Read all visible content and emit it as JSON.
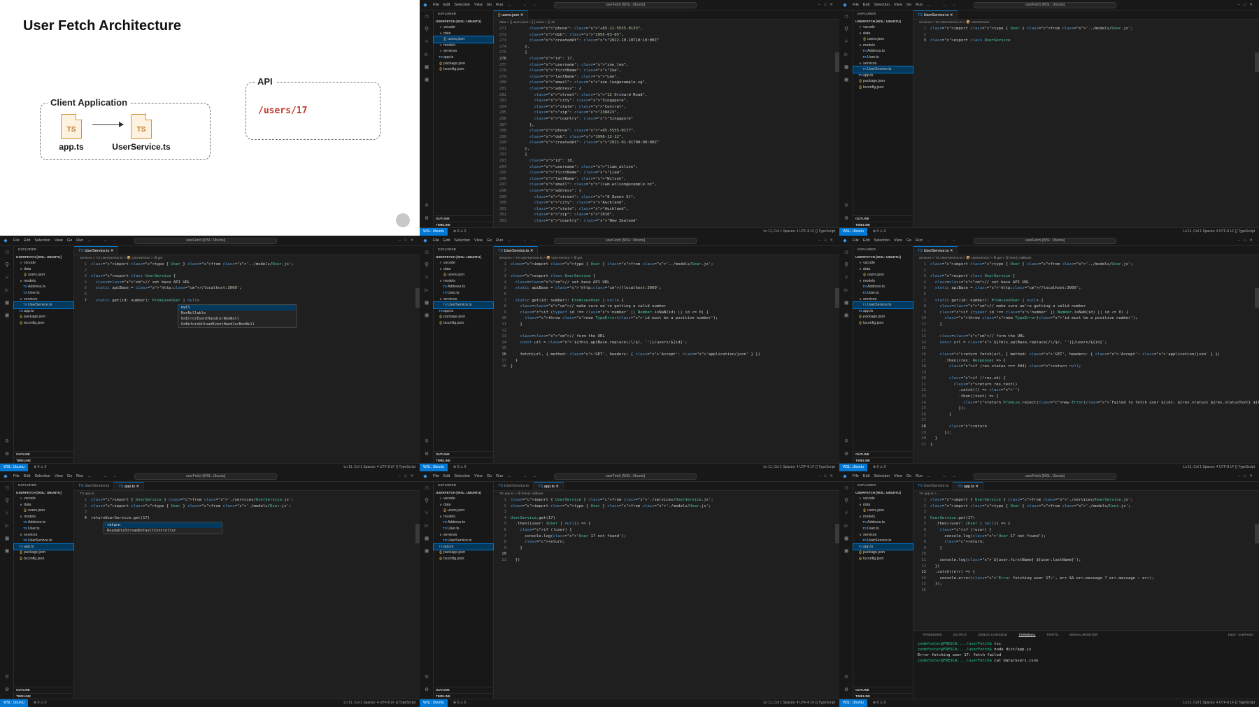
{
  "diagram": {
    "title": "User Fetch Architecture",
    "client_label": "Client Application",
    "api_label": "API",
    "route": "/users/17",
    "files": [
      "app.ts",
      "UserService.ts"
    ],
    "file_badge": "TS"
  },
  "common": {
    "menus": [
      "File",
      "Edit",
      "Selection",
      "View",
      "Go",
      "Run",
      "…"
    ],
    "search": "userFetch [WSL: Ubuntu]",
    "explorer_header": "EXPLORER",
    "root": "USERFETCH [WSL: UBUNTU]",
    "outline": "OUTLINE",
    "timeline": "TIMELINE",
    "remote": "WSL: Ubuntu",
    "problems": "⊗ 0 ⚠ 0",
    "ports": "0",
    "status_right": "Ln 11, Col 1   Spaces: 4   UTF-8   LF   {} TypeScript"
  },
  "panes": [
    null,
    {
      "tabs": [
        {
          "label": "users.json",
          "active": true,
          "icon": "{}"
        }
      ],
      "crumbs": "data > {} users.json > [ ] users > {} 16",
      "tree": [
        {
          "label": "vscode",
          "d": 1,
          "icon": ">"
        },
        {
          "label": "data",
          "d": 1,
          "icon": "v"
        },
        {
          "label": "users.json",
          "d": 2,
          "icon": "{}",
          "sel": true
        },
        {
          "label": "models",
          "d": 1,
          "icon": ">"
        },
        {
          "label": "services",
          "d": 1,
          "icon": ">"
        },
        {
          "label": "app.ts",
          "d": 1,
          "icon": "TS"
        },
        {
          "label": "package.json",
          "d": 1,
          "icon": "{}"
        },
        {
          "label": "tsconfig.json",
          "d": 1,
          "icon": "{}"
        }
      ],
      "start": 271,
      "cur": 276,
      "code": [
        "        \"phone\": \"+65-11-5555-0133\",",
        "        \"dob\": \"1995-03-05\",",
        "        \"createdAt\": \"2022-10-10T10:10:00Z\"",
        "      },",
        "      {",
        "        \"id\": 17,",
        "        \"username\": \"zoe_lee\",",
        "        \"firstName\": \"Zoe\",",
        "        \"lastName\": \"Lee\",",
        "        \"email\": \"zoe.lee@example.sg\",",
        "        \"address\": {",
        "          \"street\": \"12 Orchard Road\",",
        "          \"city\": \"Singapore\",",
        "          \"state\": \"Central\",",
        "          \"zip\": \"238823\",",
        "          \"country\": \"Singapore\"",
        "        },",
        "        \"phone\": \"+65-5555-0177\",",
        "        \"dob\": \"1996-12-12\",",
        "        \"createdAt\": \"2021-01-01T00:00:00Z\"",
        "      },",
        "      {",
        "        \"id\": 18,",
        "        \"username\": \"liam_wilson\",",
        "        \"firstName\": \"Liam\",",
        "        \"lastName\": \"Wilson\",",
        "        \"email\": \"liam.wilson@example.nz\",",
        "        \"address\": {",
        "          \"street\": \"8 Queen St\",",
        "          \"city\": \"Auckland\",",
        "          \"state\": \"Auckland\",",
        "          \"zip\": \"1010\",",
        "          \"country\": \"New Zealand\""
      ]
    },
    {
      "tabs": [
        {
          "label": "UserService.ts",
          "active": true,
          "icon": "TS"
        }
      ],
      "crumbs": "services > TS UserService.ts > 📦 UserService",
      "tree": [
        {
          "label": "vscode",
          "d": 1,
          "icon": ">"
        },
        {
          "label": "data",
          "d": 1,
          "icon": "v"
        },
        {
          "label": "users.json",
          "d": 2,
          "icon": "{}"
        },
        {
          "label": "models",
          "d": 1,
          "icon": "v"
        },
        {
          "label": "Address.ts",
          "d": 2,
          "icon": "TS"
        },
        {
          "label": "User.ts",
          "d": 2,
          "icon": "TS"
        },
        {
          "label": "services",
          "d": 1,
          "icon": "v"
        },
        {
          "label": "UserService.ts",
          "d": 2,
          "icon": "TS",
          "sel": true
        },
        {
          "label": "app.ts",
          "d": 1,
          "icon": "TS"
        },
        {
          "label": "package.json",
          "d": 1,
          "icon": "{}"
        },
        {
          "label": "tsconfig.json",
          "d": 1,
          "icon": "{}"
        }
      ],
      "start": 1,
      "cur": 3,
      "code": [
        "import type { User } from '../models/User.js';",
        "",
        "export class UserService"
      ]
    },
    {
      "tabs": [
        {
          "label": "UserService.ts",
          "active": true,
          "icon": "TS"
        }
      ],
      "crumbs": "services > TS UserService.ts > 📦 UserService > ⚙ get",
      "tree": [
        {
          "label": "vscode",
          "d": 1,
          "icon": ">"
        },
        {
          "label": "data",
          "d": 1,
          "icon": "v"
        },
        {
          "label": "users.json",
          "d": 2,
          "icon": "{}"
        },
        {
          "label": "models",
          "d": 1,
          "icon": "v"
        },
        {
          "label": "Address.ts",
          "d": 2,
          "icon": "TS"
        },
        {
          "label": "User.ts",
          "d": 2,
          "icon": "TS"
        },
        {
          "label": "services",
          "d": 1,
          "icon": "v"
        },
        {
          "label": "UserService.ts",
          "d": 2,
          "icon": "TS",
          "sel": true
        },
        {
          "label": "app.ts",
          "d": 1,
          "icon": "TS"
        },
        {
          "label": "package.json",
          "d": 1,
          "icon": "{}"
        },
        {
          "label": "tsconfig.json",
          "d": 1,
          "icon": "{}"
        }
      ],
      "start": 1,
      "cur": 7,
      "code": [
        "import type { User } from '../models/User.js';",
        "",
        "export class UserService {",
        "  // set base API URL",
        "  static apiBase = 'http://localhost:3000';",
        "",
        "  static get(id: number): Promise<User | null>"
      ],
      "popup": {
        "items": [
          "null",
          "NonNullable",
          "OnErrorEventHandlerNonNull",
          "OnBeforeUnloadEventHandlerNonNull"
        ],
        "hint": "null"
      }
    },
    {
      "tabs": [
        {
          "label": "UserService.ts",
          "active": true,
          "icon": "TS"
        }
      ],
      "crumbs": "services > TS UserService.ts > 📦 UserService > ⚙ get",
      "tree": [
        {
          "label": "vscode",
          "d": 1,
          "icon": ">"
        },
        {
          "label": "data",
          "d": 1,
          "icon": "v"
        },
        {
          "label": "users.json",
          "d": 2,
          "icon": "{}"
        },
        {
          "label": "models",
          "d": 1,
          "icon": "v"
        },
        {
          "label": "Address.ts",
          "d": 2,
          "icon": "TS"
        },
        {
          "label": "User.ts",
          "d": 2,
          "icon": "TS"
        },
        {
          "label": "services",
          "d": 1,
          "icon": "v"
        },
        {
          "label": "UserService.ts",
          "d": 2,
          "icon": "TS",
          "sel": true
        },
        {
          "label": "app.ts",
          "d": 1,
          "icon": "TS"
        },
        {
          "label": "package.json",
          "d": 1,
          "icon": "{}"
        },
        {
          "label": "tsconfig.json",
          "d": 1,
          "icon": "{}"
        }
      ],
      "start": 1,
      "cur": 16,
      "code": [
        "import type { User } from '../models/User.js';",
        "",
        "export class UserService {",
        "  // set base API URL",
        "  static apiBase = 'http://localhost:3000';",
        "",
        "  static get(id: number): Promise<User | null> {",
        "    // make sure we're getting a valid number",
        "    if (typeof id !== 'number' || Number.isNaN(id) || id <= 0) {",
        "      throw new TypeError('id must be a positive number');",
        "    }",
        "",
        "    // form the URL",
        "    const url = `${this.apiBase.replace(/\\/$/, '')}/users/${id}`;",
        "",
        "    fetch(url, { method: 'GET', headers: { 'Accept': 'application/json' } })",
        "  }",
        "}"
      ]
    },
    {
      "tabs": [
        {
          "label": "UserService.ts",
          "active": true,
          "icon": "TS"
        }
      ],
      "crumbs": "services > TS UserService.ts > 📦 UserService > ⚙ get > ⚙ then() callback",
      "tree": [
        {
          "label": "vscode",
          "d": 1,
          "icon": ">"
        },
        {
          "label": "data",
          "d": 1,
          "icon": "v"
        },
        {
          "label": "users.json",
          "d": 2,
          "icon": "{}"
        },
        {
          "label": "models",
          "d": 1,
          "icon": "v"
        },
        {
          "label": "Address.ts",
          "d": 2,
          "icon": "TS"
        },
        {
          "label": "User.ts",
          "d": 2,
          "icon": "TS"
        },
        {
          "label": "services",
          "d": 1,
          "icon": "v"
        },
        {
          "label": "UserService.ts",
          "d": 2,
          "icon": "TS",
          "sel": true
        },
        {
          "label": "app.ts",
          "d": 1,
          "icon": "TS"
        },
        {
          "label": "package.json",
          "d": 1,
          "icon": "{}"
        },
        {
          "label": "tsconfig.json",
          "d": 1,
          "icon": "{}"
        }
      ],
      "start": 1,
      "cur": 28,
      "code": [
        "import type { User } from '../models/User.js';",
        "",
        "export class UserService {",
        "  // set base API URL",
        "  static apiBase = 'http://localhost:3000';",
        "",
        "  static get(id: number): Promise<User | null> {",
        "    // make sure we're getting a valid number",
        "    if (typeof id !== 'number' || Number.isNaN(id) || id <= 0) {",
        "      throw new TypeError('id must be a positive number');",
        "    }",
        "",
        "    // form the URL",
        "    const url = `${this.apiBase.replace(/\\/$/, '')}/users/${id}`;",
        "",
        "    return fetch(url, { method: 'GET', headers: { 'Accept': 'application/json' } })",
        "      .then((res: Response) => {",
        "        if (res.status === 404) return null;",
        "",
        "        if (!res.ok) {",
        "          return res.text()",
        "            .catch(() => '')",
        "            .then((text) => {",
        "              return Promise.reject(new Error(`Failed to fetch user ${id}: ${res.status} ${res.statusText} ${text}`));",
        "            });",
        "        }",
        "",
        "        return ",
        "      });",
        "  }",
        "}"
      ]
    },
    {
      "tabs": [
        {
          "label": "UserService.ts",
          "active": false,
          "icon": "TS"
        },
        {
          "label": "app.ts",
          "active": true,
          "icon": "TS"
        }
      ],
      "crumbs": "TS app.ts",
      "tree": [
        {
          "label": "vscode",
          "d": 1,
          "icon": ">"
        },
        {
          "label": "data",
          "d": 1,
          "icon": "v"
        },
        {
          "label": "users.json",
          "d": 2,
          "icon": "{}"
        },
        {
          "label": "models",
          "d": 1,
          "icon": "v"
        },
        {
          "label": "Address.ts",
          "d": 2,
          "icon": "TS"
        },
        {
          "label": "User.ts",
          "d": 2,
          "icon": "TS"
        },
        {
          "label": "services",
          "d": 1,
          "icon": "v"
        },
        {
          "label": "UserService.ts",
          "d": 2,
          "icon": "TS"
        },
        {
          "label": "app.ts",
          "d": 1,
          "icon": "TS",
          "sel": true
        },
        {
          "label": "package.json",
          "d": 1,
          "icon": "{}"
        },
        {
          "label": "tsconfig.json",
          "d": 1,
          "icon": "{}"
        }
      ],
      "start": 1,
      "cur": 4,
      "code": [
        "import { UserService } from './services/UserService.js';",
        "import type { User } from './models/User.js';",
        "",
        "returnUserService.get(17)"
      ],
      "popup": {
        "items": [
          "return",
          "ReadableStreamDefaultController"
        ],
        "hint": "return"
      }
    },
    {
      "tabs": [
        {
          "label": "UserService.ts",
          "active": false,
          "icon": "TS"
        },
        {
          "label": "app.ts",
          "active": true,
          "icon": "TS"
        }
      ],
      "crumbs": "TS app.ts > ⚙ then() callback",
      "tree": [
        {
          "label": "vscode",
          "d": 1,
          "icon": ">"
        },
        {
          "label": "data",
          "d": 1,
          "icon": "v"
        },
        {
          "label": "users.json",
          "d": 2,
          "icon": "{}"
        },
        {
          "label": "models",
          "d": 1,
          "icon": "v"
        },
        {
          "label": "Address.ts",
          "d": 2,
          "icon": "TS"
        },
        {
          "label": "User.ts",
          "d": 2,
          "icon": "TS"
        },
        {
          "label": "services",
          "d": 1,
          "icon": "v"
        },
        {
          "label": "UserService.ts",
          "d": 2,
          "icon": "TS"
        },
        {
          "label": "app.ts",
          "d": 1,
          "icon": "TS",
          "sel": true
        },
        {
          "label": "package.json",
          "d": 1,
          "icon": "{}"
        },
        {
          "label": "tsconfig.json",
          "d": 1,
          "icon": "{}"
        }
      ],
      "start": 1,
      "cur": 10,
      "code": [
        "import { UserService } from './services/UserService.js';",
        "import type { User } from './models/User.js';",
        "",
        "UserService.get(17)",
        "  .then((user: (User | null)) => {",
        "    if (!user) {",
        "      console.log('User 17 not found');",
        "      return;",
        "    }",
        "",
        "  })"
      ]
    },
    {
      "tabs": [
        {
          "label": "UserService.ts",
          "active": false,
          "icon": "TS"
        },
        {
          "label": "app.ts",
          "active": true,
          "icon": "TS"
        }
      ],
      "crumbs": "TS app.ts > ...",
      "tree": [
        {
          "label": "vscode",
          "d": 1,
          "icon": ">"
        },
        {
          "label": "data",
          "d": 1,
          "icon": "v"
        },
        {
          "label": "users.json",
          "d": 2,
          "icon": "{}"
        },
        {
          "label": "models",
          "d": 1,
          "icon": "v"
        },
        {
          "label": "Address.ts",
          "d": 2,
          "icon": "TS"
        },
        {
          "label": "User.ts",
          "d": 2,
          "icon": "TS"
        },
        {
          "label": "services",
          "d": 1,
          "icon": "v"
        },
        {
          "label": "UserService.ts",
          "d": 2,
          "icon": "TS"
        },
        {
          "label": "app.ts",
          "d": 1,
          "icon": "TS",
          "sel": true
        },
        {
          "label": "package.json",
          "d": 1,
          "icon": "{}"
        },
        {
          "label": "tsconfig.json",
          "d": 1,
          "icon": "{}"
        }
      ],
      "start": 1,
      "cur": 13,
      "code": [
        "import { UserService } from './services/UserService.js';",
        "import type { User } from './models/User.js';",
        "",
        "UserService.get(17)",
        "  .then((user: (User | null)) => {",
        "    if (!user) {",
        "      console.log('User 17 not found');",
        "      return;",
        "    }",
        "",
        "    console.log(`${user.firstName} ${user.lastName}`);",
        "  })",
        "  .catch((err) => {",
        "    console.error('Error fetching user 17:', err && err.message ? err.message : err);",
        "  });",
        ""
      ],
      "panel": {
        "tabs": [
          "PROBLEMS",
          "OUTPUT",
          "DEBUG CONSOLE",
          "TERMINAL",
          "PORTS",
          "SERIAL MONITOR"
        ],
        "active": 3,
        "shell": "bash - userFetch",
        "lines": [
          {
            "prompt": "codefoster@FRESCA:.../userFetch$",
            "cmd": " tsc"
          },
          {
            "prompt": "codefoster@FRESCA:.../userFetch$",
            "cmd": " node dist/app.js"
          },
          {
            "prompt": "",
            "cmd": "Error fetching user 17: fetch failed"
          },
          {
            "prompt": "codefoster@FRESCA:.../userFetch$",
            "cmd": " cat data/users.json"
          }
        ]
      }
    }
  ]
}
